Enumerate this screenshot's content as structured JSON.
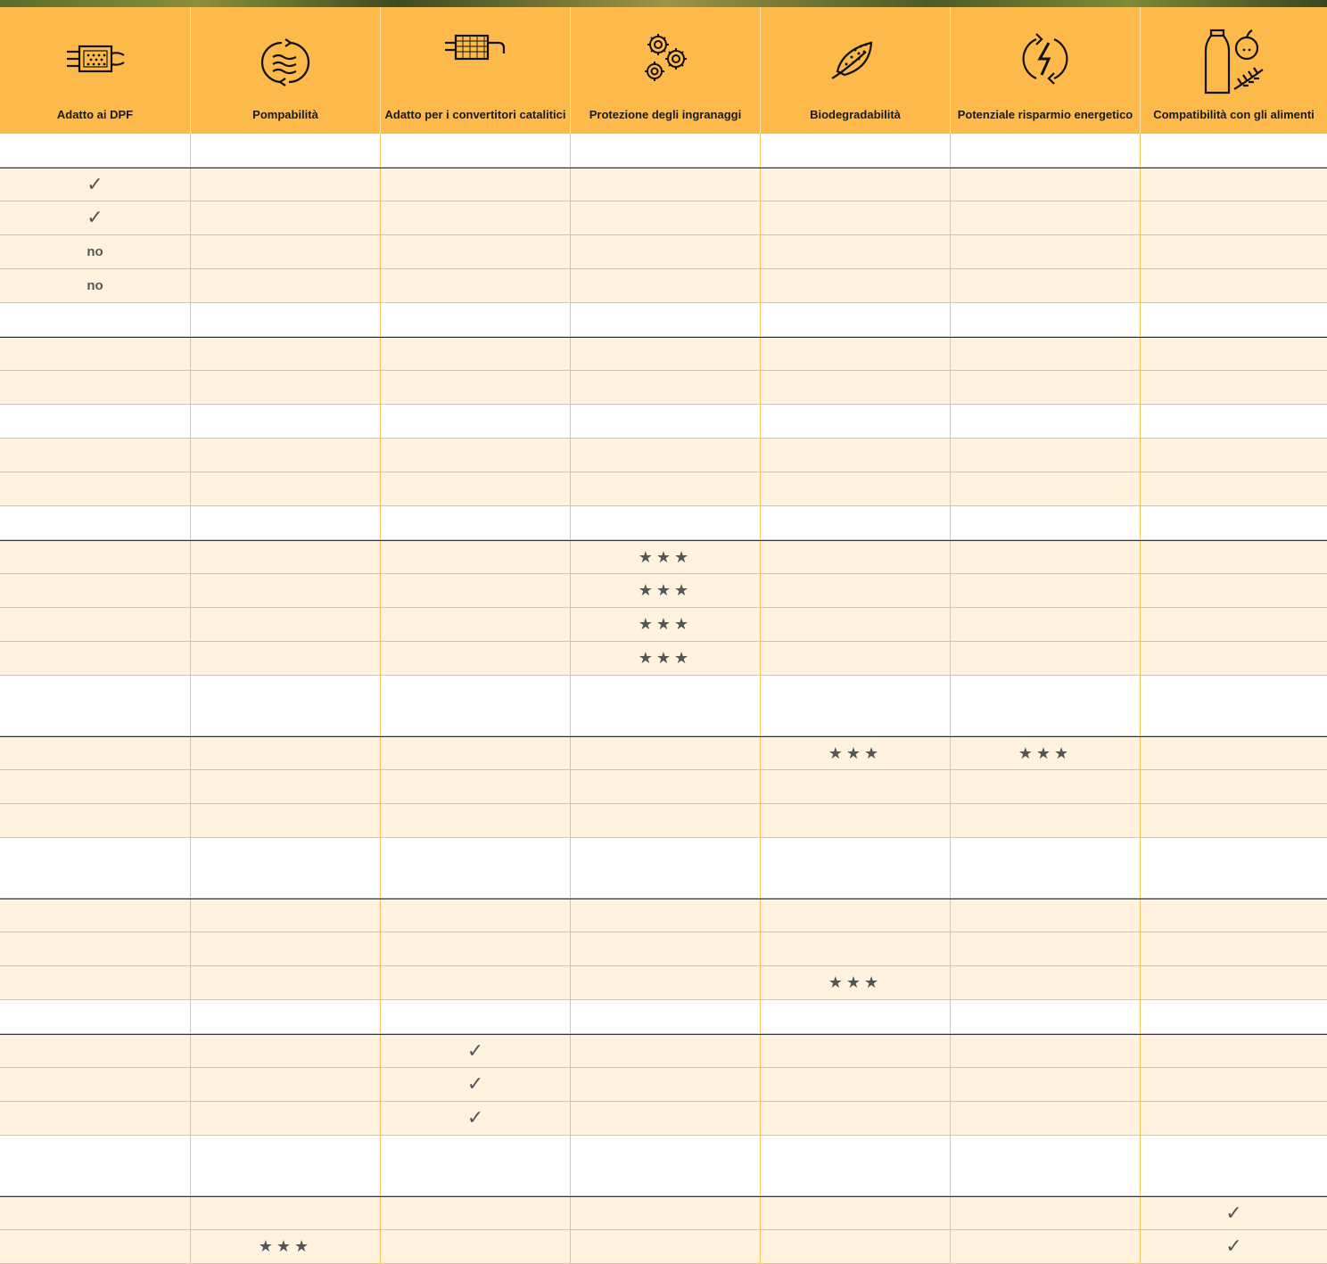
{
  "colors": {
    "header_bg": "#fdb94a",
    "row_tint": "#fff3e0",
    "grid_line": "#f6c45e",
    "group_divider": "#333333"
  },
  "columns": [
    {
      "label": "Adatto ai DPF",
      "icon": "dpf-filter-icon"
    },
    {
      "label": "Pompabilità",
      "icon": "pumpability-icon"
    },
    {
      "label": "Adatto per i convertitori catalitici",
      "icon": "catalytic-converter-icon"
    },
    {
      "label": "Protezione degli ingranaggi",
      "icon": "gears-icon"
    },
    {
      "label": "Biodegradabilità",
      "icon": "biodegradable-leaf-icon"
    },
    {
      "label": "Potenziale risparmio energetico",
      "icon": "energy-saving-icon"
    },
    {
      "label": "Compatibilità con gli alimenti",
      "icon": "food-compatibility-icon"
    }
  ],
  "rows": [
    {
      "style": "plain",
      "cells": [
        "",
        "",
        "",
        "",
        "",
        "",
        ""
      ]
    },
    {
      "style": "tinted",
      "cells": [
        "✓",
        "",
        "",
        "",
        "",
        "",
        ""
      ]
    },
    {
      "style": "tinted",
      "cells": [
        "✓",
        "",
        "",
        "",
        "",
        "",
        ""
      ]
    },
    {
      "style": "tinted",
      "cells": [
        "no",
        "",
        "",
        "",
        "",
        "",
        ""
      ]
    },
    {
      "style": "tinted",
      "cells": [
        "no",
        "",
        "",
        "",
        "",
        "",
        ""
      ]
    },
    {
      "style": "plain",
      "cells": [
        "",
        "",
        "",
        "",
        "",
        "",
        ""
      ]
    },
    {
      "style": "tinted",
      "cells": [
        "",
        "",
        "",
        "",
        "",
        "",
        ""
      ]
    },
    {
      "style": "tinted",
      "cells": [
        "",
        "",
        "",
        "",
        "",
        "",
        ""
      ]
    },
    {
      "style": "plain",
      "cells": [
        "",
        "",
        "",
        "",
        "",
        "",
        ""
      ]
    },
    {
      "style": "tinted",
      "cells": [
        "",
        "",
        "",
        "",
        "",
        "",
        ""
      ]
    },
    {
      "style": "tinted",
      "cells": [
        "",
        "",
        "",
        "",
        "",
        "",
        ""
      ]
    },
    {
      "style": "plain",
      "cells": [
        "",
        "",
        "",
        "",
        "",
        "",
        ""
      ]
    },
    {
      "style": "tinted",
      "cells": [
        "",
        "",
        "",
        "★★★",
        "",
        "",
        ""
      ]
    },
    {
      "style": "tinted",
      "cells": [
        "",
        "",
        "",
        "★★★",
        "",
        "",
        ""
      ]
    },
    {
      "style": "tinted",
      "cells": [
        "",
        "",
        "",
        "★★★",
        "",
        "",
        ""
      ]
    },
    {
      "style": "tinted",
      "cells": [
        "",
        "",
        "",
        "★★★",
        "",
        "",
        ""
      ]
    },
    {
      "style": "plain",
      "cells": [
        "",
        "",
        "",
        "",
        "",
        "",
        ""
      ]
    },
    {
      "style": "tinted",
      "cells": [
        "",
        "",
        "",
        "",
        "★★★",
        "★★★",
        ""
      ]
    },
    {
      "style": "tinted",
      "cells": [
        "",
        "",
        "",
        "",
        "",
        "",
        ""
      ]
    },
    {
      "style": "tinted",
      "cells": [
        "",
        "",
        "",
        "",
        "",
        "",
        ""
      ]
    },
    {
      "style": "plain",
      "cells": [
        "",
        "",
        "",
        "",
        "",
        "",
        ""
      ]
    },
    {
      "style": "tinted",
      "cells": [
        "",
        "",
        "",
        "",
        "",
        "",
        ""
      ]
    },
    {
      "style": "tinted",
      "cells": [
        "",
        "",
        "",
        "",
        "",
        "",
        ""
      ]
    },
    {
      "style": "tinted",
      "cells": [
        "",
        "",
        "",
        "",
        "★★★",
        "",
        ""
      ]
    },
    {
      "style": "plain",
      "cells": [
        "",
        "",
        "",
        "",
        "",
        "",
        ""
      ]
    },
    {
      "style": "tinted",
      "cells": [
        "",
        "",
        "✓",
        "",
        "",
        "",
        ""
      ]
    },
    {
      "style": "tinted",
      "cells": [
        "",
        "",
        "✓",
        "",
        "",
        "",
        ""
      ]
    },
    {
      "style": "tinted",
      "cells": [
        "",
        "",
        "✓",
        "",
        "",
        "",
        ""
      ]
    },
    {
      "style": "plain",
      "cells": [
        "",
        "",
        "",
        "",
        "",
        "",
        ""
      ]
    },
    {
      "style": "tinted",
      "cells": [
        "",
        "",
        "",
        "",
        "",
        "",
        "✓"
      ]
    },
    {
      "style": "tinted",
      "cells": [
        "",
        "★★★",
        "",
        "",
        "",
        "",
        "✓"
      ]
    }
  ]
}
